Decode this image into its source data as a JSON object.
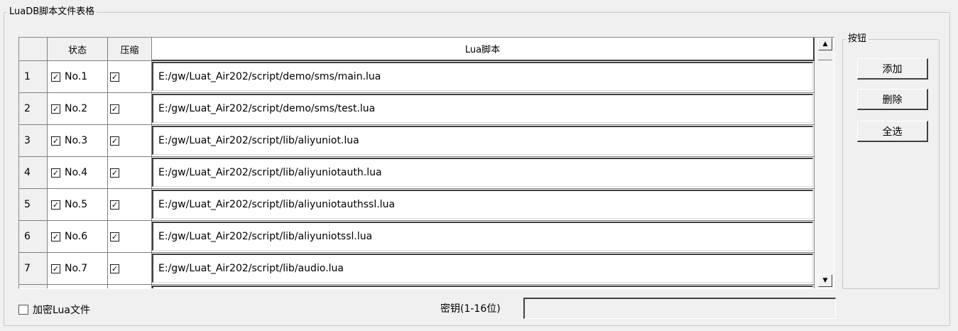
{
  "outer_group": {
    "title": "LuaDB脚本文件表格"
  },
  "table": {
    "headers": {
      "status": "状态",
      "compress": "压缩",
      "script": "Lua脚本"
    },
    "rows": [
      {
        "index": "1",
        "status_checked": true,
        "status_label": "No.1",
        "compress_checked": true,
        "path": "E:/gw/Luat_Air202/script/demo/sms/main.lua"
      },
      {
        "index": "2",
        "status_checked": true,
        "status_label": "No.2",
        "compress_checked": true,
        "path": "E:/gw/Luat_Air202/script/demo/sms/test.lua"
      },
      {
        "index": "3",
        "status_checked": true,
        "status_label": "No.3",
        "compress_checked": true,
        "path": "E:/gw/Luat_Air202/script/lib/aliyuniot.lua"
      },
      {
        "index": "4",
        "status_checked": true,
        "status_label": "No.4",
        "compress_checked": true,
        "path": "E:/gw/Luat_Air202/script/lib/aliyuniotauth.lua"
      },
      {
        "index": "5",
        "status_checked": true,
        "status_label": "No.5",
        "compress_checked": true,
        "path": "E:/gw/Luat_Air202/script/lib/aliyuniotauthssl.lua"
      },
      {
        "index": "6",
        "status_checked": true,
        "status_label": "No.6",
        "compress_checked": true,
        "path": "E:/gw/Luat_Air202/script/lib/aliyuniotssl.lua"
      },
      {
        "index": "7",
        "status_checked": true,
        "status_label": "No.7",
        "compress_checked": true,
        "path": "E:/gw/Luat_Air202/script/lib/audio.lua"
      },
      {
        "index": "",
        "status_checked": false,
        "status_label": "",
        "compress_checked": false,
        "path": ""
      }
    ]
  },
  "button_group": {
    "title": "按钮",
    "add_label": "添加",
    "delete_label": "删除",
    "select_all_label": "全选"
  },
  "footer": {
    "encrypt_checked": false,
    "encrypt_label": "加密Lua文件",
    "key_label": "密钥(1-16位)",
    "key_value": ""
  },
  "icons": {
    "scroll_up": "arrow-up-icon",
    "scroll_down": "arrow-down-icon"
  }
}
